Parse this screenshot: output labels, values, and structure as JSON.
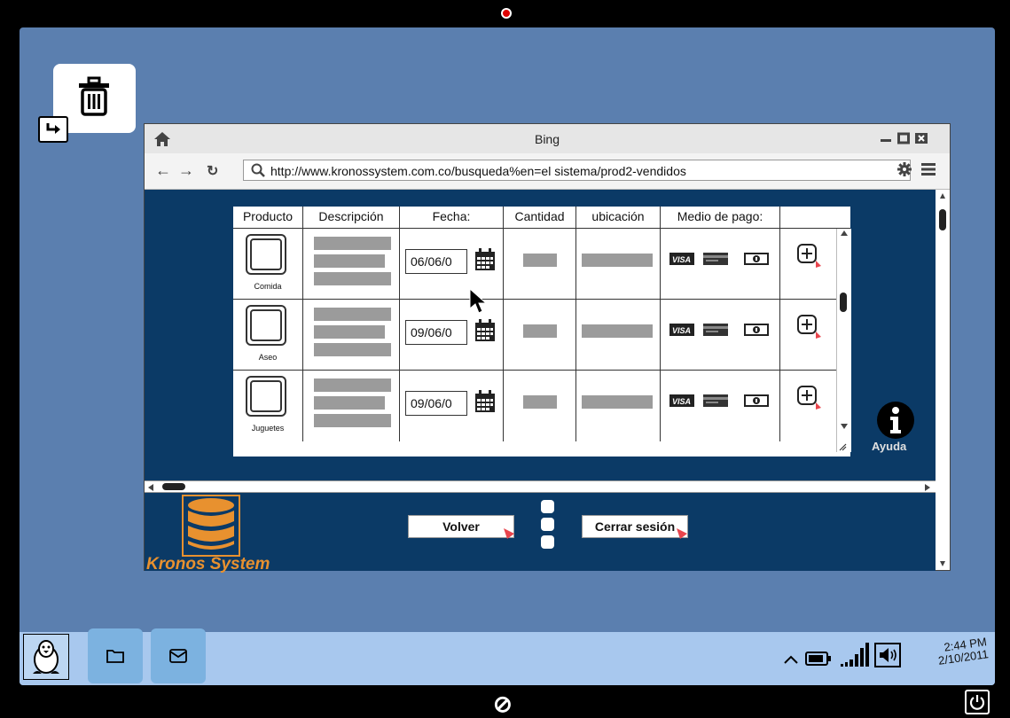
{
  "browser": {
    "title": "Bing",
    "url": "http://www.kronossystem.com.co/busqueda%en=el sistema/prod2-vendidos"
  },
  "table": {
    "headers": [
      "Producto",
      "Descripción",
      "Fecha:",
      "Cantidad",
      "ubicación",
      "Medio de pago:",
      ""
    ],
    "rows": [
      {
        "product": "Comida",
        "date": "06/06/0"
      },
      {
        "product": "Aseo",
        "date": "09/06/0"
      },
      {
        "product": "Juguetes",
        "date": "09/06/0"
      }
    ]
  },
  "payment_icons": [
    "visa-card-icon",
    "credit-card-icon",
    "cash-icon"
  ],
  "footer": {
    "logo_text": "Kronos System",
    "back_label": "Volver",
    "logout_label": "Cerrar sesión"
  },
  "help": {
    "label": "Ayuda"
  },
  "taskbar": {
    "time": "2:44 PM",
    "date": "2/10/2011"
  },
  "colors": {
    "screen_bg": "#5b7faf",
    "page_bg": "#0b3a66",
    "taskbar_bg": "#a8c8ee",
    "accent_orange": "#e8912f"
  }
}
